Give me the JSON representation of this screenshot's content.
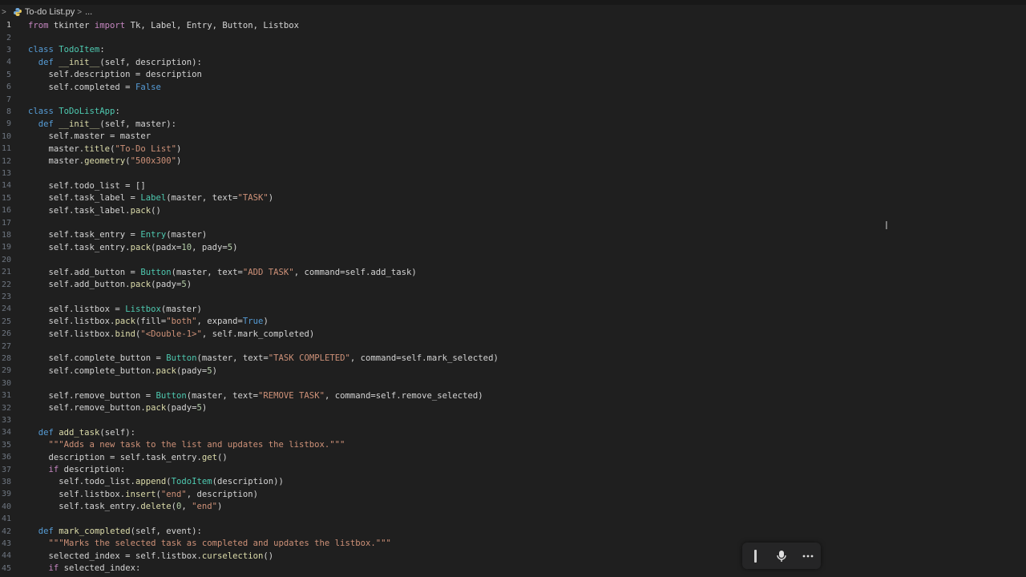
{
  "breadcrumb": {
    "file": "To-do List.py",
    "more": "...",
    "icon": "python-file-icon"
  },
  "editor": {
    "active_line": 1,
    "lines": [
      {
        "n": "1",
        "tokens": [
          {
            "t": "from",
            "c": "t-ctl"
          },
          {
            "t": " tkinter ",
            "c": "t-txt"
          },
          {
            "t": "import",
            "c": "t-ctl"
          },
          {
            "t": " Tk, Label, Entry, Button, Listbox",
            "c": "t-txt"
          }
        ]
      },
      {
        "n": "2",
        "tokens": []
      },
      {
        "n": "3",
        "tokens": [
          {
            "t": "class",
            "c": "t-kw"
          },
          {
            "t": " ",
            "c": "t-txt"
          },
          {
            "t": "TodoItem",
            "c": "t-cls"
          },
          {
            "t": ":",
            "c": "t-txt"
          }
        ]
      },
      {
        "n": "4",
        "tokens": [
          {
            "t": "  ",
            "c": "t-txt"
          },
          {
            "t": "def",
            "c": "t-kw"
          },
          {
            "t": " ",
            "c": "t-txt"
          },
          {
            "t": "__init__",
            "c": "t-fn"
          },
          {
            "t": "(self, description):",
            "c": "t-txt"
          }
        ]
      },
      {
        "n": "5",
        "tokens": [
          {
            "t": "    self.description = description",
            "c": "t-txt"
          }
        ]
      },
      {
        "n": "6",
        "tokens": [
          {
            "t": "    self.completed = ",
            "c": "t-txt"
          },
          {
            "t": "False",
            "c": "t-kw"
          }
        ]
      },
      {
        "n": "7",
        "tokens": []
      },
      {
        "n": "8",
        "tokens": [
          {
            "t": "class",
            "c": "t-kw"
          },
          {
            "t": " ",
            "c": "t-txt"
          },
          {
            "t": "ToDoListApp",
            "c": "t-cls"
          },
          {
            "t": ":",
            "c": "t-txt"
          }
        ]
      },
      {
        "n": "9",
        "tokens": [
          {
            "t": "  ",
            "c": "t-txt"
          },
          {
            "t": "def",
            "c": "t-kw"
          },
          {
            "t": " ",
            "c": "t-txt"
          },
          {
            "t": "__init__",
            "c": "t-fn"
          },
          {
            "t": "(self, master):",
            "c": "t-txt"
          }
        ]
      },
      {
        "n": "10",
        "tokens": [
          {
            "t": "    self.master = master",
            "c": "t-txt"
          }
        ]
      },
      {
        "n": "11",
        "tokens": [
          {
            "t": "    master.",
            "c": "t-txt"
          },
          {
            "t": "title",
            "c": "t-fn"
          },
          {
            "t": "(",
            "c": "t-txt"
          },
          {
            "t": "\"To-Do List\"",
            "c": "t-str"
          },
          {
            "t": ")",
            "c": "t-txt"
          }
        ]
      },
      {
        "n": "12",
        "tokens": [
          {
            "t": "    master.",
            "c": "t-txt"
          },
          {
            "t": "geometry",
            "c": "t-fn"
          },
          {
            "t": "(",
            "c": "t-txt"
          },
          {
            "t": "\"500x300\"",
            "c": "t-str"
          },
          {
            "t": ")",
            "c": "t-txt"
          }
        ]
      },
      {
        "n": "13",
        "tokens": []
      },
      {
        "n": "14",
        "tokens": [
          {
            "t": "    self.todo_list = []",
            "c": "t-txt"
          }
        ]
      },
      {
        "n": "15",
        "tokens": [
          {
            "t": "    self.task_label = ",
            "c": "t-txt"
          },
          {
            "t": "Label",
            "c": "t-cls"
          },
          {
            "t": "(master, text=",
            "c": "t-txt"
          },
          {
            "t": "\"TASK\"",
            "c": "t-str"
          },
          {
            "t": ")",
            "c": "t-txt"
          }
        ]
      },
      {
        "n": "16",
        "tokens": [
          {
            "t": "    self.task_label.",
            "c": "t-txt"
          },
          {
            "t": "pack",
            "c": "t-fn"
          },
          {
            "t": "()",
            "c": "t-txt"
          }
        ]
      },
      {
        "n": "17",
        "tokens": []
      },
      {
        "n": "18",
        "tokens": [
          {
            "t": "    self.task_entry = ",
            "c": "t-txt"
          },
          {
            "t": "Entry",
            "c": "t-cls"
          },
          {
            "t": "(master)",
            "c": "t-txt"
          }
        ]
      },
      {
        "n": "19",
        "tokens": [
          {
            "t": "    self.task_entry.",
            "c": "t-txt"
          },
          {
            "t": "pack",
            "c": "t-fn"
          },
          {
            "t": "(padx=",
            "c": "t-txt"
          },
          {
            "t": "10",
            "c": "t-num"
          },
          {
            "t": ", pady=",
            "c": "t-txt"
          },
          {
            "t": "5",
            "c": "t-num"
          },
          {
            "t": ")",
            "c": "t-txt"
          }
        ]
      },
      {
        "n": "20",
        "tokens": []
      },
      {
        "n": "21",
        "tokens": [
          {
            "t": "    self.add_button = ",
            "c": "t-txt"
          },
          {
            "t": "Button",
            "c": "t-cls"
          },
          {
            "t": "(master, text=",
            "c": "t-txt"
          },
          {
            "t": "\"ADD TASK\"",
            "c": "t-str"
          },
          {
            "t": ", command=self.add_task)",
            "c": "t-txt"
          }
        ]
      },
      {
        "n": "22",
        "tokens": [
          {
            "t": "    self.add_button.",
            "c": "t-txt"
          },
          {
            "t": "pack",
            "c": "t-fn"
          },
          {
            "t": "(pady=",
            "c": "t-txt"
          },
          {
            "t": "5",
            "c": "t-num"
          },
          {
            "t": ")",
            "c": "t-txt"
          }
        ]
      },
      {
        "n": "23",
        "tokens": []
      },
      {
        "n": "24",
        "tokens": [
          {
            "t": "    self.listbox = ",
            "c": "t-txt"
          },
          {
            "t": "Listbox",
            "c": "t-cls"
          },
          {
            "t": "(master)",
            "c": "t-txt"
          }
        ]
      },
      {
        "n": "25",
        "tokens": [
          {
            "t": "    self.listbox.",
            "c": "t-txt"
          },
          {
            "t": "pack",
            "c": "t-fn"
          },
          {
            "t": "(fill=",
            "c": "t-txt"
          },
          {
            "t": "\"both\"",
            "c": "t-str"
          },
          {
            "t": ", expand=",
            "c": "t-txt"
          },
          {
            "t": "True",
            "c": "t-kw"
          },
          {
            "t": ")",
            "c": "t-txt"
          }
        ]
      },
      {
        "n": "26",
        "tokens": [
          {
            "t": "    self.listbox.",
            "c": "t-txt"
          },
          {
            "t": "bind",
            "c": "t-fn"
          },
          {
            "t": "(",
            "c": "t-txt"
          },
          {
            "t": "\"<Double-1>\"",
            "c": "t-str"
          },
          {
            "t": ", self.mark_completed)",
            "c": "t-txt"
          }
        ]
      },
      {
        "n": "27",
        "tokens": []
      },
      {
        "n": "28",
        "tokens": [
          {
            "t": "    self.complete_button = ",
            "c": "t-txt"
          },
          {
            "t": "Button",
            "c": "t-cls"
          },
          {
            "t": "(master, text=",
            "c": "t-txt"
          },
          {
            "t": "\"TASK COMPLETED\"",
            "c": "t-str"
          },
          {
            "t": ", command=self.mark_selected)",
            "c": "t-txt"
          }
        ]
      },
      {
        "n": "29",
        "tokens": [
          {
            "t": "    self.complete_button.",
            "c": "t-txt"
          },
          {
            "t": "pack",
            "c": "t-fn"
          },
          {
            "t": "(pady=",
            "c": "t-txt"
          },
          {
            "t": "5",
            "c": "t-num"
          },
          {
            "t": ")",
            "c": "t-txt"
          }
        ]
      },
      {
        "n": "30",
        "tokens": []
      },
      {
        "n": "31",
        "tokens": [
          {
            "t": "    self.remove_button = ",
            "c": "t-txt"
          },
          {
            "t": "Button",
            "c": "t-cls"
          },
          {
            "t": "(master, text=",
            "c": "t-txt"
          },
          {
            "t": "\"REMOVE TASK\"",
            "c": "t-str"
          },
          {
            "t": ", command=self.remove_selected)",
            "c": "t-txt"
          }
        ]
      },
      {
        "n": "32",
        "tokens": [
          {
            "t": "    self.remove_button.",
            "c": "t-txt"
          },
          {
            "t": "pack",
            "c": "t-fn"
          },
          {
            "t": "(pady=",
            "c": "t-txt"
          },
          {
            "t": "5",
            "c": "t-num"
          },
          {
            "t": ")",
            "c": "t-txt"
          }
        ]
      },
      {
        "n": "33",
        "tokens": []
      },
      {
        "n": "34",
        "tokens": [
          {
            "t": "  ",
            "c": "t-txt"
          },
          {
            "t": "def",
            "c": "t-kw"
          },
          {
            "t": " ",
            "c": "t-txt"
          },
          {
            "t": "add_task",
            "c": "t-fn"
          },
          {
            "t": "(self):",
            "c": "t-txt"
          }
        ]
      },
      {
        "n": "35",
        "tokens": [
          {
            "t": "    ",
            "c": "t-txt"
          },
          {
            "t": "\"\"\"Adds a new task to the list and updates the listbox.\"\"\"",
            "c": "t-str"
          }
        ]
      },
      {
        "n": "36",
        "tokens": [
          {
            "t": "    description = self.task_entry.",
            "c": "t-txt"
          },
          {
            "t": "get",
            "c": "t-fn"
          },
          {
            "t": "()",
            "c": "t-txt"
          }
        ]
      },
      {
        "n": "37",
        "tokens": [
          {
            "t": "    ",
            "c": "t-txt"
          },
          {
            "t": "if",
            "c": "t-ctl"
          },
          {
            "t": " description:",
            "c": "t-txt"
          }
        ]
      },
      {
        "n": "38",
        "tokens": [
          {
            "t": "      self.todo_list.",
            "c": "t-txt"
          },
          {
            "t": "append",
            "c": "t-fn"
          },
          {
            "t": "(",
            "c": "t-txt"
          },
          {
            "t": "TodoItem",
            "c": "t-cls"
          },
          {
            "t": "(description))",
            "c": "t-txt"
          }
        ]
      },
      {
        "n": "39",
        "tokens": [
          {
            "t": "      self.listbox.",
            "c": "t-txt"
          },
          {
            "t": "insert",
            "c": "t-fn"
          },
          {
            "t": "(",
            "c": "t-txt"
          },
          {
            "t": "\"end\"",
            "c": "t-str"
          },
          {
            "t": ", description)",
            "c": "t-txt"
          }
        ]
      },
      {
        "n": "40",
        "tokens": [
          {
            "t": "      self.task_entry.",
            "c": "t-txt"
          },
          {
            "t": "delete",
            "c": "t-fn"
          },
          {
            "t": "(",
            "c": "t-txt"
          },
          {
            "t": "0",
            "c": "t-num"
          },
          {
            "t": ", ",
            "c": "t-txt"
          },
          {
            "t": "\"end\"",
            "c": "t-str"
          },
          {
            "t": ")",
            "c": "t-txt"
          }
        ]
      },
      {
        "n": "41",
        "tokens": []
      },
      {
        "n": "42",
        "tokens": [
          {
            "t": "  ",
            "c": "t-txt"
          },
          {
            "t": "def",
            "c": "t-kw"
          },
          {
            "t": " ",
            "c": "t-txt"
          },
          {
            "t": "mark_completed",
            "c": "t-fn"
          },
          {
            "t": "(self, event):",
            "c": "t-txt"
          }
        ]
      },
      {
        "n": "43",
        "tokens": [
          {
            "t": "    ",
            "c": "t-txt"
          },
          {
            "t": "\"\"\"Marks the selected task as completed and updates the listbox.\"\"\"",
            "c": "t-str"
          }
        ]
      },
      {
        "n": "44",
        "tokens": [
          {
            "t": "    selected_index = self.listbox.",
            "c": "t-txt"
          },
          {
            "t": "curselection",
            "c": "t-fn"
          },
          {
            "t": "()",
            "c": "t-txt"
          }
        ]
      },
      {
        "n": "45",
        "tokens": [
          {
            "t": "    ",
            "c": "t-txt"
          },
          {
            "t": "if",
            "c": "t-ctl"
          },
          {
            "t": " selected_index:",
            "c": "t-txt"
          }
        ]
      }
    ]
  },
  "voice_toolbar": {
    "buttons": [
      {
        "name": "drag-handle-icon"
      },
      {
        "name": "microphone-icon"
      },
      {
        "name": "more-icon"
      }
    ]
  },
  "colors": {
    "background": "#1f1f1f",
    "keyword": "#569cd6",
    "control": "#c586c0",
    "class": "#4ec9b0",
    "function": "#dcdcaa",
    "string": "#ce9178",
    "number": "#b5cea8"
  }
}
